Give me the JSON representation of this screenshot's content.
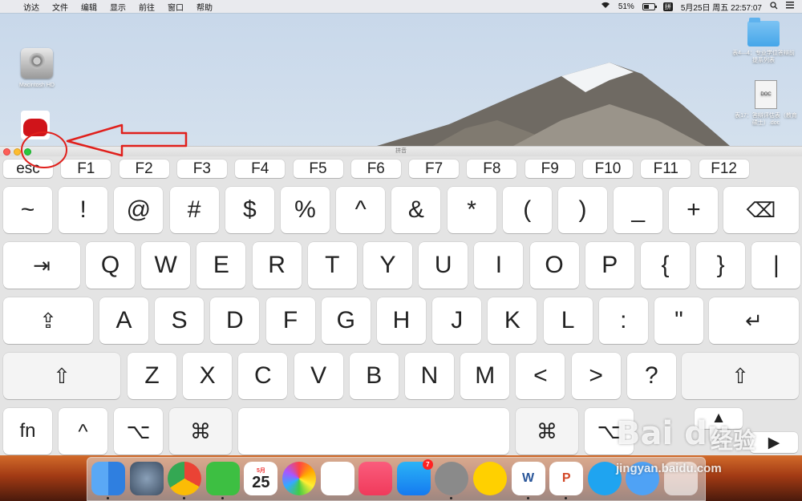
{
  "menubar": {
    "apple_icon": "apple-icon",
    "items": [
      "访达",
      "文件",
      "编辑",
      "显示",
      "前往",
      "窗口",
      "帮助"
    ],
    "status": {
      "battery_percent_text": "51%",
      "battery_level": 0.51,
      "ime": "拼",
      "datetime": "5月25日 周五  22:57:07"
    }
  },
  "desktop": {
    "hd_label": "Macintosh HD",
    "folder_label": "表4—4：专业学位答辩前提系列表",
    "doc_label": "表17：答辩评估表（教育硕士）.doc",
    "doc_type": "DOC"
  },
  "keyboard_viewer": {
    "title": "拼音",
    "fn_row": [
      "esc",
      "F1",
      "F2",
      "F3",
      "F4",
      "F5",
      "F6",
      "F7",
      "F8",
      "F9",
      "F10",
      "F11",
      "F12"
    ],
    "row1": [
      "~",
      "!",
      "@",
      "#",
      "$",
      "%",
      "^",
      "&",
      "*",
      "(",
      ")",
      "_",
      "+"
    ],
    "row1_delete": "⌫",
    "row2_tab": "⇥",
    "row2": [
      "Q",
      "W",
      "E",
      "R",
      "T",
      "Y",
      "U",
      "I",
      "O",
      "P",
      "{",
      "}",
      "|"
    ],
    "row3_caps": "⇪",
    "row3": [
      "A",
      "S",
      "D",
      "F",
      "G",
      "H",
      "J",
      "K",
      "L",
      ":",
      "\""
    ],
    "row3_return": "↵",
    "row4_shift_left": "⇧",
    "row4": [
      "Z",
      "X",
      "C",
      "V",
      "B",
      "N",
      "M",
      "<",
      ">",
      "?"
    ],
    "row4_shift_right": "⇧",
    "row5": {
      "fn": "fn",
      "control": "^",
      "option_left": "⌥",
      "command_left": "⌘",
      "command_right": "⌘",
      "option_right": "⌥",
      "arrow_up": "▲",
      "arrow_right": "▶"
    }
  },
  "dock": {
    "items": [
      "finder-icon",
      "launchpad-icon",
      "chrome-icon",
      "wechat-icon",
      "calendar-icon",
      "photos-icon",
      "numbers-icon",
      "music-icon",
      "app-store-icon",
      "system-preferences-icon",
      "video-player-icon",
      "word-icon",
      "powerpoint-icon",
      "video-app-icon",
      "browser-icon",
      "trash-icon"
    ],
    "calendar_month": "5月",
    "calendar_day": "25",
    "app_store_badge": "7",
    "word_letter": "W",
    "powerpoint_letter": "P"
  },
  "watermark": {
    "logo": "Bai du",
    "cn": "经验",
    "url": "jingyan.baidu.com"
  },
  "colors": {
    "close": "#fd5f57",
    "minimize": "#fdbc2e",
    "zoom": "#28c840",
    "annotation": "#e0201c"
  }
}
